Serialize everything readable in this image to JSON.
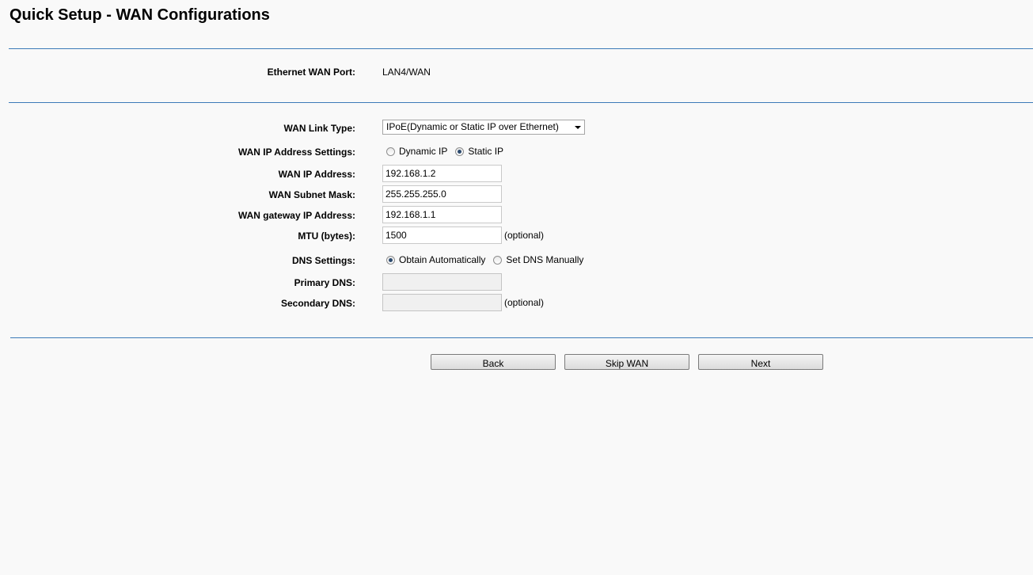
{
  "page": {
    "title": "Quick Setup - WAN Configurations"
  },
  "ethernet": {
    "label": "Ethernet WAN Port:",
    "value": "LAN4/WAN"
  },
  "wan": {
    "link_type_label": "WAN Link Type:",
    "link_type_value": "IPoE(Dynamic or Static IP over Ethernet)",
    "ip_settings_label": "WAN IP Address Settings:",
    "ip_settings_options": [
      {
        "label": "Dynamic IP",
        "checked": false
      },
      {
        "label": "Static IP",
        "checked": true
      }
    ],
    "ip_address_label": "WAN IP Address:",
    "ip_address_value": "192.168.1.2",
    "subnet_label": "WAN Subnet Mask:",
    "subnet_value": "255.255.255.0",
    "gateway_label": "WAN gateway IP Address:",
    "gateway_value": "192.168.1.1",
    "mtu_label": "MTU (bytes):",
    "mtu_value": "1500",
    "mtu_note": "(optional)"
  },
  "dns": {
    "settings_label": "DNS Settings:",
    "options": [
      {
        "label": "Obtain Automatically",
        "checked": true
      },
      {
        "label": "Set DNS Manually",
        "checked": false
      }
    ],
    "primary_label": "Primary DNS:",
    "primary_value": "",
    "secondary_label": "Secondary DNS:",
    "secondary_value": "",
    "secondary_note": "(optional)"
  },
  "buttons": {
    "back": "Back",
    "skip": "Skip WAN",
    "next": "Next"
  }
}
